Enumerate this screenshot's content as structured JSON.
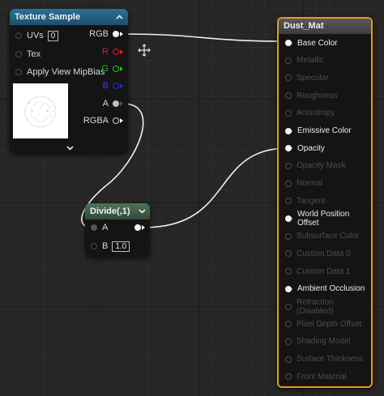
{
  "texture_sample": {
    "title": "Texture Sample",
    "inputs": [
      {
        "label": "UVs",
        "value": "0"
      },
      {
        "label": "Tex"
      },
      {
        "label": "Apply View MipBias"
      }
    ],
    "outputs": [
      {
        "label": "RGB",
        "color": "#f4f4f4"
      },
      {
        "label": "R",
        "color": "#e22020"
      },
      {
        "label": "G",
        "color": "#20c020"
      },
      {
        "label": "B",
        "color": "#2828e0"
      },
      {
        "label": "A",
        "color": "#cfcfcf"
      },
      {
        "label": "RGBA",
        "color": "#cfcfcf"
      }
    ],
    "header_color": "#215c7e"
  },
  "divide": {
    "title": "Divide(,1)",
    "input_a": "A",
    "input_b": "B",
    "b_value": "1.0",
    "header_color": "#3d5a45"
  },
  "material": {
    "title": "Dust_Mat",
    "border_color": "#e49a1c",
    "inputs": [
      {
        "label": "Base Color",
        "active": true,
        "connected": true
      },
      {
        "label": "Metallic",
        "active": false
      },
      {
        "label": "Specular",
        "active": false
      },
      {
        "label": "Roughness",
        "active": false
      },
      {
        "label": "Anisotropy",
        "active": false
      },
      {
        "label": "Emissive Color",
        "active": true
      },
      {
        "label": "Opacity",
        "active": true,
        "connected": true
      },
      {
        "label": "Opacity Mask",
        "active": false
      },
      {
        "label": "Normal",
        "active": false
      },
      {
        "label": "Tangent",
        "active": false
      },
      {
        "label": "World Position Offset",
        "active": true
      },
      {
        "label": "Subsurface Color",
        "active": false
      },
      {
        "label": "Custom Data 0",
        "active": false
      },
      {
        "label": "Custom Data 1",
        "active": false
      },
      {
        "label": "Ambient Occlusion",
        "active": true
      },
      {
        "label": "Refraction (Disabled)",
        "active": false
      },
      {
        "label": "Pixel Depth Offset",
        "active": false
      },
      {
        "label": "Shading Model",
        "active": false
      },
      {
        "label": "Surface Thickness",
        "active": false
      },
      {
        "label": "Front Material",
        "active": false
      }
    ]
  },
  "icons": {
    "move_cursor": "move-cursor-icon",
    "collapse_chevron": "chevron-up-icon",
    "expand_chevron": "chevron-down-icon"
  }
}
